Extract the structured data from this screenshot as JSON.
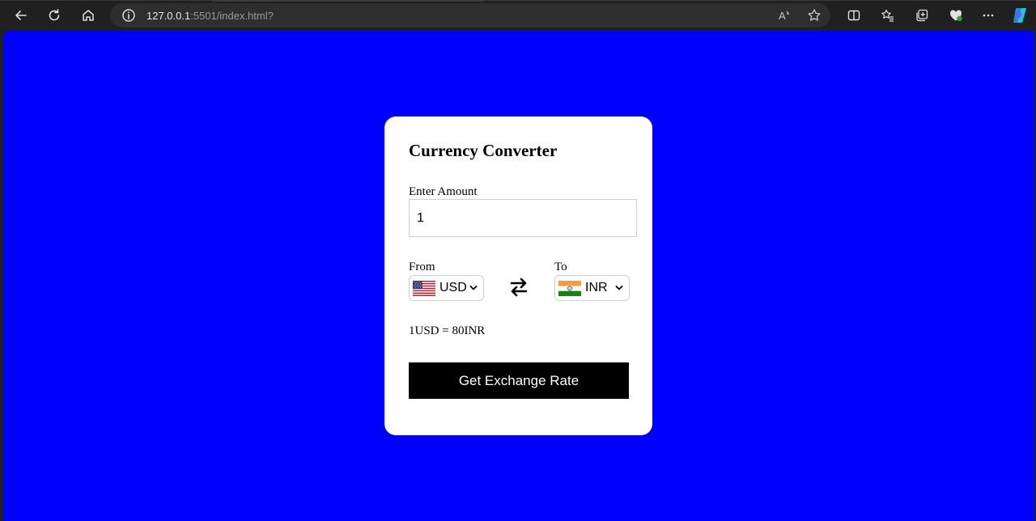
{
  "browser": {
    "url_host": "127.0.0.1",
    "url_rest": ":5501/index.html?",
    "icons": [
      "back-icon",
      "refresh-icon",
      "home-icon",
      "info-icon",
      "read-aloud-icon",
      "favorite-icon",
      "split-screen-icon",
      "favorites-list-icon",
      "collections-icon",
      "browser-essentials-icon",
      "more-icon",
      "copilot-icon"
    ]
  },
  "page": {
    "background_color": "#0000ff",
    "title": "Currency Converter",
    "amount_label": "Enter Amount",
    "amount_value": "1",
    "from_label": "From",
    "to_label": "To",
    "from_currency": "USD",
    "to_currency": "INR",
    "rate_text": "1USD = 80INR",
    "button_label": "Get Exchange Rate"
  }
}
